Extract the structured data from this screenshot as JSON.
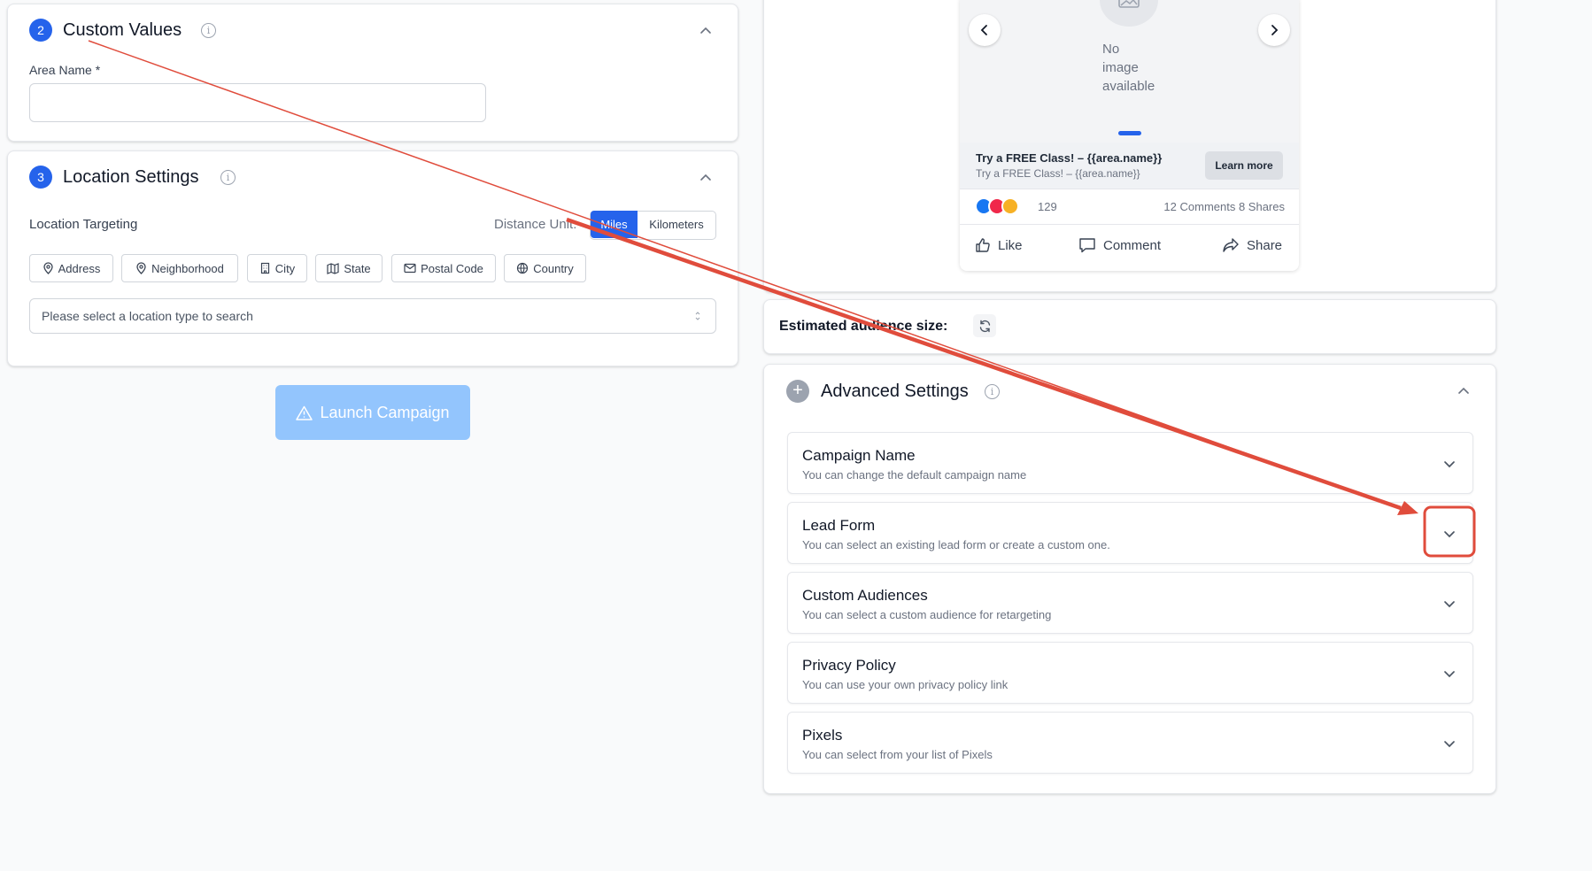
{
  "colors": {
    "primary": "#2563eb",
    "launch_disabled": "#93c5fd",
    "annotation": "#e04c3c"
  },
  "custom_values": {
    "step": "2",
    "title": "Custom Values",
    "area_label": "Area Name",
    "required_mark": "*",
    "area_value": ""
  },
  "location_settings": {
    "step": "3",
    "title": "Location Settings",
    "targeting_label": "Location Targeting",
    "distance_label": "Distance Unit:",
    "units": [
      {
        "label": "Miles",
        "selected": true
      },
      {
        "label": "Kilometers",
        "selected": false
      }
    ],
    "types": [
      {
        "label": "Address",
        "icon": "map-pin-icon"
      },
      {
        "label": "Neighborhood",
        "icon": "map-pin-icon"
      },
      {
        "label": "City",
        "icon": "building-icon"
      },
      {
        "label": "State",
        "icon": "map-icon"
      },
      {
        "label": "Postal Code",
        "icon": "mail-icon"
      },
      {
        "label": "Country",
        "icon": "globe-icon"
      }
    ],
    "select_placeholder": "Please select a location type to search"
  },
  "launch": {
    "label": "Launch Campaign",
    "icon": "warning-triangle-icon"
  },
  "ad_preview": {
    "no_image_text": [
      "No",
      "image",
      "available"
    ],
    "headline": "Try a FREE Class! – {{area.name}}",
    "subline": "Try a FREE Class! – {{area.name}}",
    "cta_label": "Learn more",
    "reaction_count": "129",
    "engagement": "12 Comments 8 Shares",
    "actions": {
      "like": "Like",
      "comment": "Comment",
      "share": "Share"
    }
  },
  "audience": {
    "label": "Estimated audience size:",
    "icon": "refresh-icon"
  },
  "advanced": {
    "title": "Advanced Settings",
    "items": [
      {
        "title": "Campaign Name",
        "subtitle": "You can change the default campaign name"
      },
      {
        "title": "Lead Form",
        "subtitle": "You can select an existing lead form or create a custom one."
      },
      {
        "title": "Custom Audiences",
        "subtitle": "You can select a custom audience for retargeting"
      },
      {
        "title": "Privacy Policy",
        "subtitle": "You can use your own privacy policy link"
      },
      {
        "title": "Pixels",
        "subtitle": "You can select from your list of Pixels"
      }
    ]
  }
}
